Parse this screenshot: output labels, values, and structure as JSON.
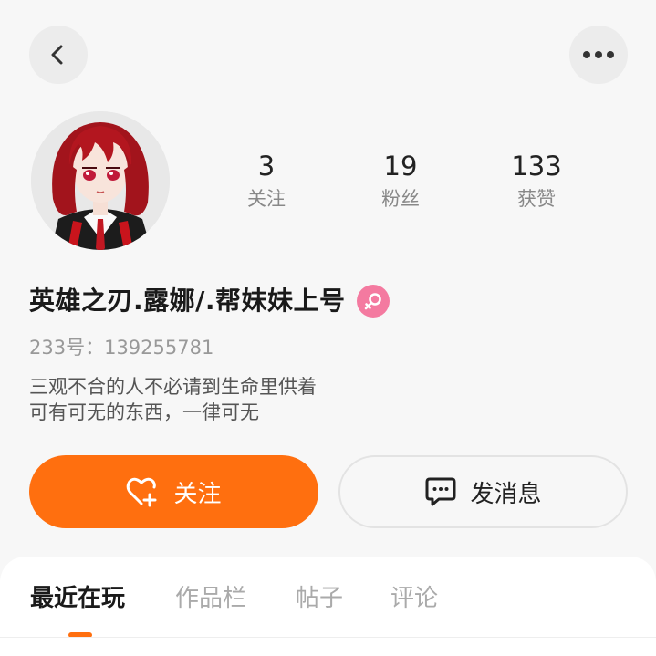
{
  "header": {
    "back_icon": "chevron-left-icon",
    "more_icon": "more-horizontal-icon"
  },
  "profile": {
    "avatar": "anime-girl-avatar",
    "stats": [
      {
        "value": "3",
        "label": "关注"
      },
      {
        "value": "19",
        "label": "粉丝"
      },
      {
        "value": "133",
        "label": "获赞"
      }
    ],
    "name": "英雄之刃.露娜/.帮妹妹上号",
    "gender": "female",
    "gender_color": "#f47aa0",
    "uid": "233号：139255781",
    "bio_line1": "三观不合的人不必请到生命里供着",
    "bio_line2": "可有可无的东西，一律可无"
  },
  "actions": {
    "follow_label": "关注",
    "follow_icon": "heart-plus-icon",
    "message_label": "发消息",
    "message_icon": "chat-bubble-icon",
    "accent_color": "#ff6f0f"
  },
  "tabs": [
    {
      "label": "最近在玩",
      "active": true
    },
    {
      "label": "作品栏",
      "active": false
    },
    {
      "label": "帖子",
      "active": false
    },
    {
      "label": "评论",
      "active": false
    }
  ]
}
